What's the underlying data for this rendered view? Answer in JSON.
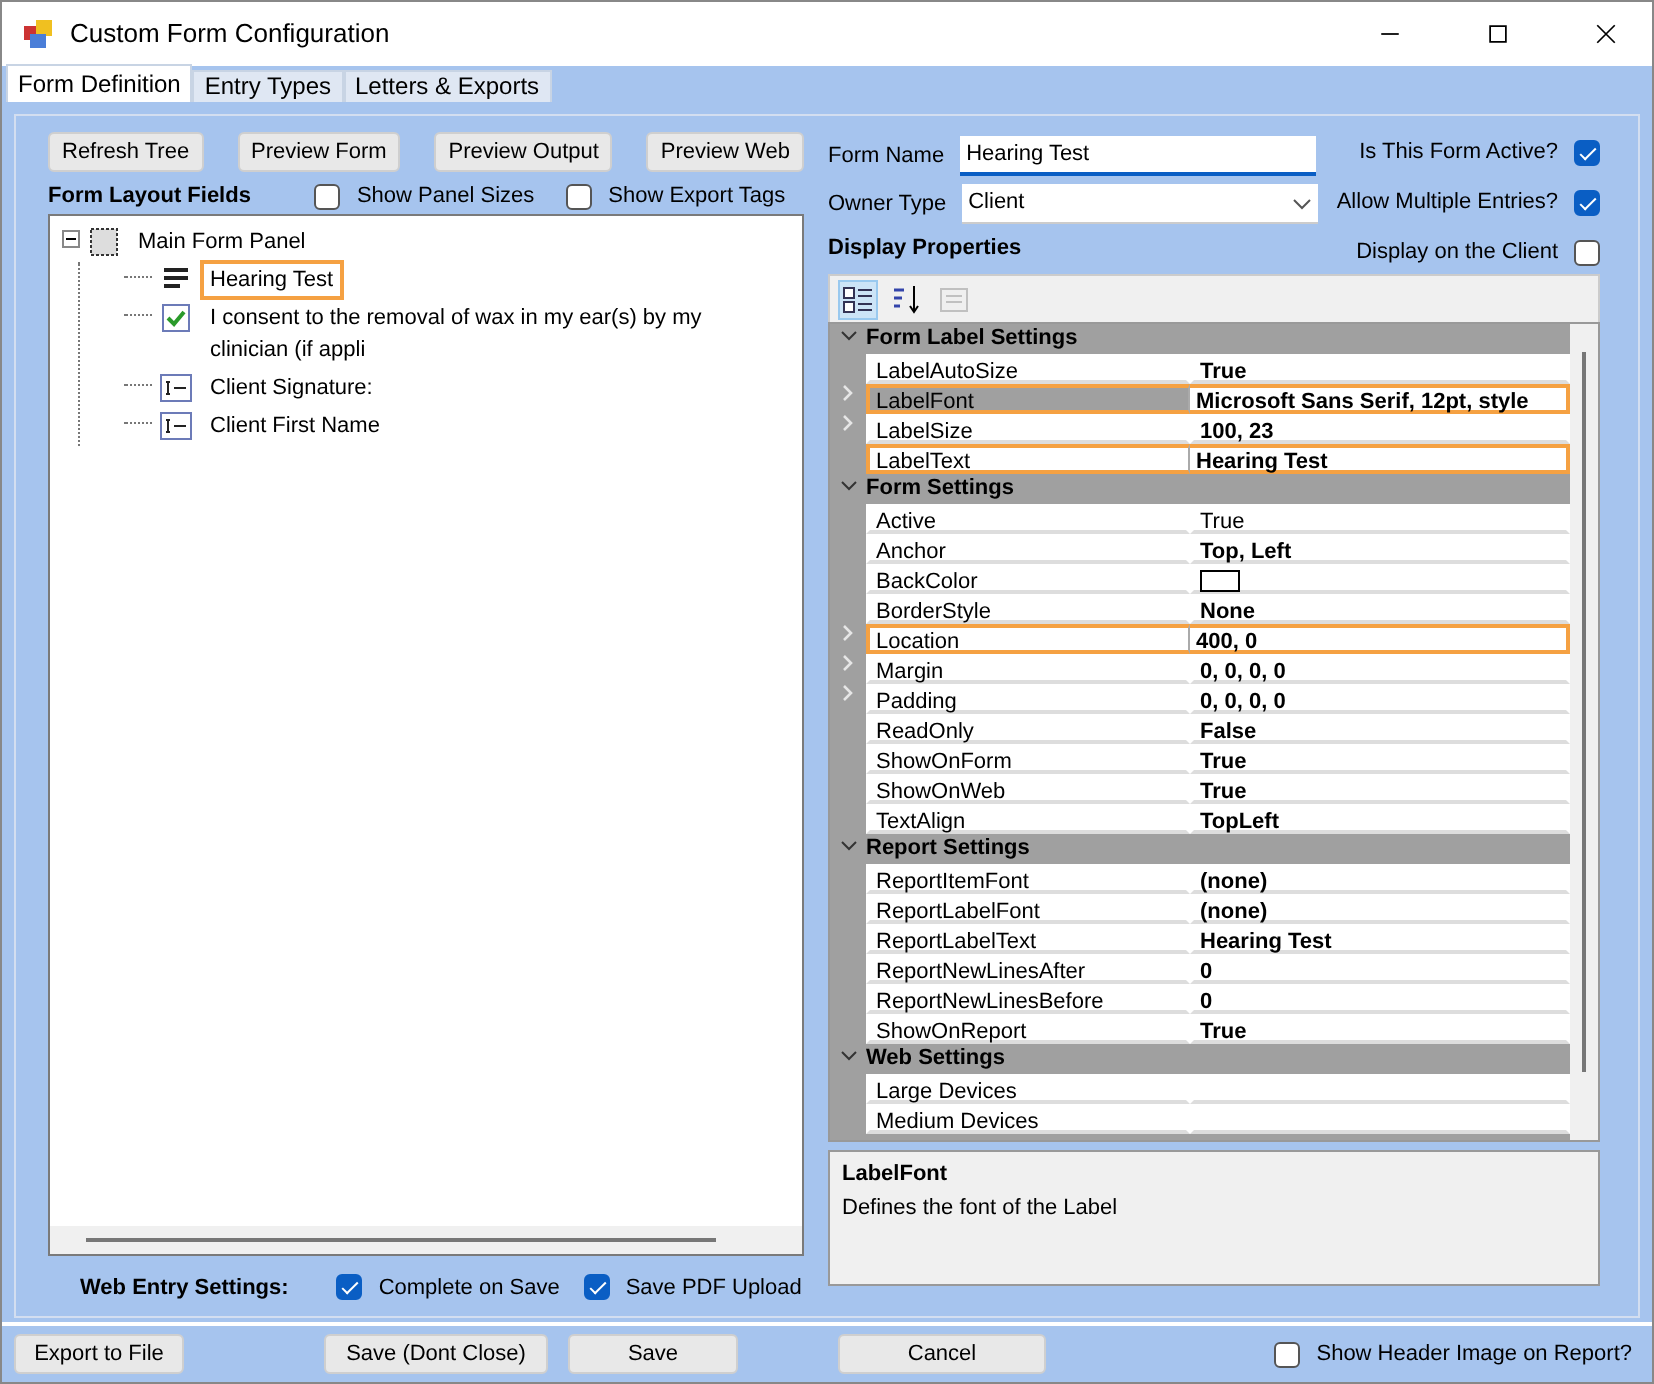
{
  "window": {
    "title": "Custom Form Configuration"
  },
  "tabs": [
    {
      "label": "Form Definition",
      "selected": true
    },
    {
      "label": "Entry Types",
      "selected": false
    },
    {
      "label": "Letters & Exports",
      "selected": false
    }
  ],
  "toolbar_buttons": [
    "Refresh Tree",
    "Preview Form",
    "Preview Output",
    "Preview Web"
  ],
  "form_layout_fields": {
    "title": "Form Layout Fields",
    "options": [
      {
        "label": "Show Panel Sizes",
        "checked": false
      },
      {
        "label": "Show Export Tags",
        "checked": false
      }
    ],
    "tree": [
      {
        "label": "Main Form Panel",
        "kind": "panel",
        "expanded": true,
        "highlighted": false,
        "children": [
          {
            "label": "Hearing Test",
            "kind": "label",
            "highlighted": true
          },
          {
            "label": "I consent to the removal of wax in my ear(s) by my clinician (if appli",
            "kind": "checkbox",
            "highlighted": false
          },
          {
            "label": "Client Signature:",
            "kind": "textbox",
            "highlighted": false
          },
          {
            "label": "Client First Name",
            "kind": "textbox",
            "highlighted": false
          }
        ]
      }
    ]
  },
  "form": {
    "name_label": "Form Name",
    "name_value": "Hearing Test",
    "owner_label": "Owner Type",
    "owner_value": "Client",
    "flags": [
      {
        "label": "Is This Form Active?",
        "checked": true
      },
      {
        "label": "Allow Multiple Entries?",
        "checked": true
      },
      {
        "label": "Display on the Client",
        "checked": false
      }
    ]
  },
  "display_properties": {
    "title": "Display Properties",
    "view_buttons": [
      {
        "kind": "categorized",
        "selected": true,
        "disabled": false
      },
      {
        "kind": "alphabetical",
        "selected": false,
        "disabled": false
      },
      {
        "kind": "pages",
        "selected": false,
        "disabled": true
      }
    ],
    "categories": [
      {
        "name": "Form Label Settings",
        "expanded": true,
        "properties": [
          {
            "name": "LabelAutoSize",
            "value": "True",
            "modified": true,
            "expandable": false,
            "highlighted": false,
            "selected": false,
            "kind": "text"
          },
          {
            "name": "LabelFont",
            "value": "Microsoft Sans Serif, 12pt, style",
            "modified": true,
            "expandable": true,
            "highlighted": true,
            "selected": true,
            "kind": "text"
          },
          {
            "name": "LabelSize",
            "value": "100, 23",
            "modified": true,
            "expandable": true,
            "highlighted": false,
            "selected": false,
            "kind": "text"
          },
          {
            "name": "LabelText",
            "value": "Hearing Test",
            "modified": true,
            "expandable": false,
            "highlighted": true,
            "selected": false,
            "kind": "text"
          }
        ]
      },
      {
        "name": "Form Settings",
        "expanded": true,
        "properties": [
          {
            "name": "Active",
            "value": "True",
            "modified": false,
            "expandable": false,
            "highlighted": false,
            "selected": false,
            "kind": "text"
          },
          {
            "name": "Anchor",
            "value": "Top, Left",
            "modified": true,
            "expandable": false,
            "highlighted": false,
            "selected": false,
            "kind": "text"
          },
          {
            "name": "BackColor",
            "color": "#ffffff",
            "expandable": false,
            "highlighted": false,
            "selected": false,
            "kind": "color"
          },
          {
            "name": "BorderStyle",
            "value": "None",
            "modified": true,
            "expandable": false,
            "highlighted": false,
            "selected": false,
            "kind": "text"
          },
          {
            "name": "Location",
            "value": "400, 0",
            "modified": true,
            "expandable": true,
            "highlighted": true,
            "selected": false,
            "kind": "text"
          },
          {
            "name": "Margin",
            "value": "0, 0, 0, 0",
            "modified": true,
            "expandable": true,
            "highlighted": false,
            "selected": false,
            "kind": "text"
          },
          {
            "name": "Padding",
            "value": "0, 0, 0, 0",
            "modified": true,
            "expandable": true,
            "highlighted": false,
            "selected": false,
            "kind": "text"
          },
          {
            "name": "ReadOnly",
            "value": "False",
            "modified": true,
            "expandable": false,
            "highlighted": false,
            "selected": false,
            "kind": "text"
          },
          {
            "name": "ShowOnForm",
            "value": "True",
            "modified": true,
            "expandable": false,
            "highlighted": false,
            "selected": false,
            "kind": "text"
          },
          {
            "name": "ShowOnWeb",
            "value": "True",
            "modified": true,
            "expandable": false,
            "highlighted": false,
            "selected": false,
            "kind": "text"
          },
          {
            "name": "TextAlign",
            "value": "TopLeft",
            "modified": true,
            "expandable": false,
            "highlighted": false,
            "selected": false,
            "kind": "text"
          }
        ]
      },
      {
        "name": "Report Settings",
        "expanded": true,
        "properties": [
          {
            "name": "ReportItemFont",
            "value": "(none)",
            "modified": true,
            "expandable": false,
            "highlighted": false,
            "selected": false,
            "kind": "text"
          },
          {
            "name": "ReportLabelFont",
            "value": "(none)",
            "modified": true,
            "expandable": false,
            "highlighted": false,
            "selected": false,
            "kind": "text"
          },
          {
            "name": "ReportLabelText",
            "value": "Hearing Test",
            "modified": true,
            "expandable": false,
            "highlighted": false,
            "selected": false,
            "kind": "text"
          },
          {
            "name": "ReportNewLinesAfter",
            "value": "0",
            "modified": true,
            "expandable": false,
            "highlighted": false,
            "selected": false,
            "kind": "text"
          },
          {
            "name": "ReportNewLinesBefore",
            "value": "0",
            "modified": true,
            "expandable": false,
            "highlighted": false,
            "selected": false,
            "kind": "text"
          },
          {
            "name": "ShowOnReport",
            "value": "True",
            "modified": true,
            "expandable": false,
            "highlighted": false,
            "selected": false,
            "kind": "text"
          }
        ]
      },
      {
        "name": "Web Settings",
        "expanded": true,
        "properties": [
          {
            "name": "Large Devices",
            "expandable": false,
            "highlighted": false,
            "selected": false,
            "kind": "text"
          },
          {
            "name": "Medium Devices",
            "expandable": false,
            "highlighted": false,
            "selected": false,
            "kind": "text"
          }
        ]
      }
    ],
    "description": {
      "title": "LabelFont",
      "text": "Defines the font of the Label"
    }
  },
  "web_entry": {
    "label": "Web Entry Settings:",
    "options": [
      {
        "label": "Complete on Save",
        "checked": true
      },
      {
        "label": "Save PDF Upload",
        "checked": true
      }
    ]
  },
  "footer_buttons": [
    "Export to File",
    "Save (Dont Close)",
    "Save",
    "Cancel"
  ],
  "header_image_option": {
    "label": "Show Header Image on Report?",
    "checked": false
  }
}
